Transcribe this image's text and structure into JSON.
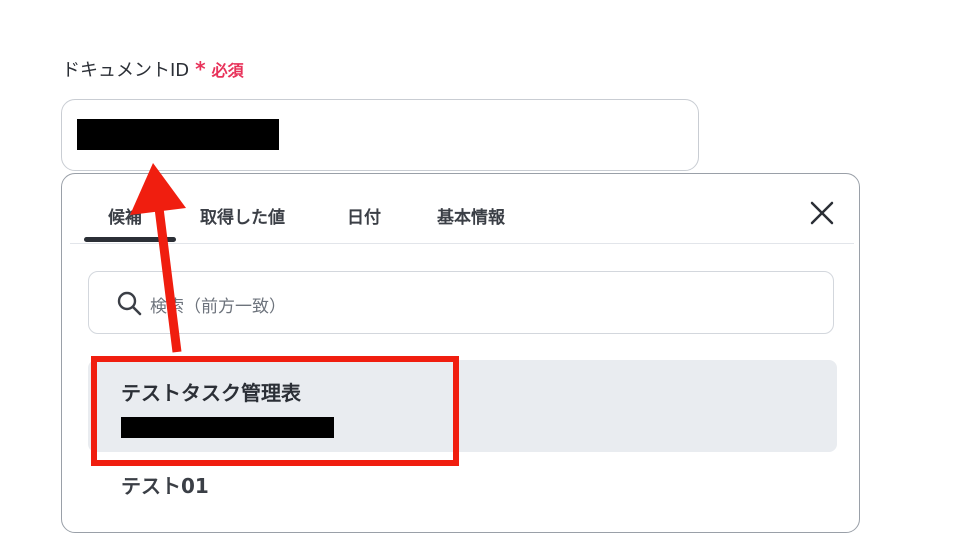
{
  "field": {
    "label": "ドキュメントID",
    "required_star": "*",
    "required_text": "必須",
    "value": ""
  },
  "dropdown": {
    "tabs": [
      {
        "label": "候補",
        "active": true
      },
      {
        "label": "取得した値",
        "active": false
      },
      {
        "label": "日付",
        "active": false
      },
      {
        "label": "基本情報",
        "active": false
      }
    ],
    "close_icon": "close-icon",
    "search": {
      "icon": "search-icon",
      "placeholder": "検索（前方一致）"
    },
    "options": [
      {
        "title": "テストタスク管理表",
        "selected": true
      },
      {
        "title": "テスト01",
        "selected": false
      }
    ]
  },
  "annotation": {
    "highlight_color": "#f01e0f",
    "arrow_color": "#f01e0f"
  },
  "colors": {
    "required": "#e8325a",
    "selected_bg": "#e9ecf0"
  }
}
